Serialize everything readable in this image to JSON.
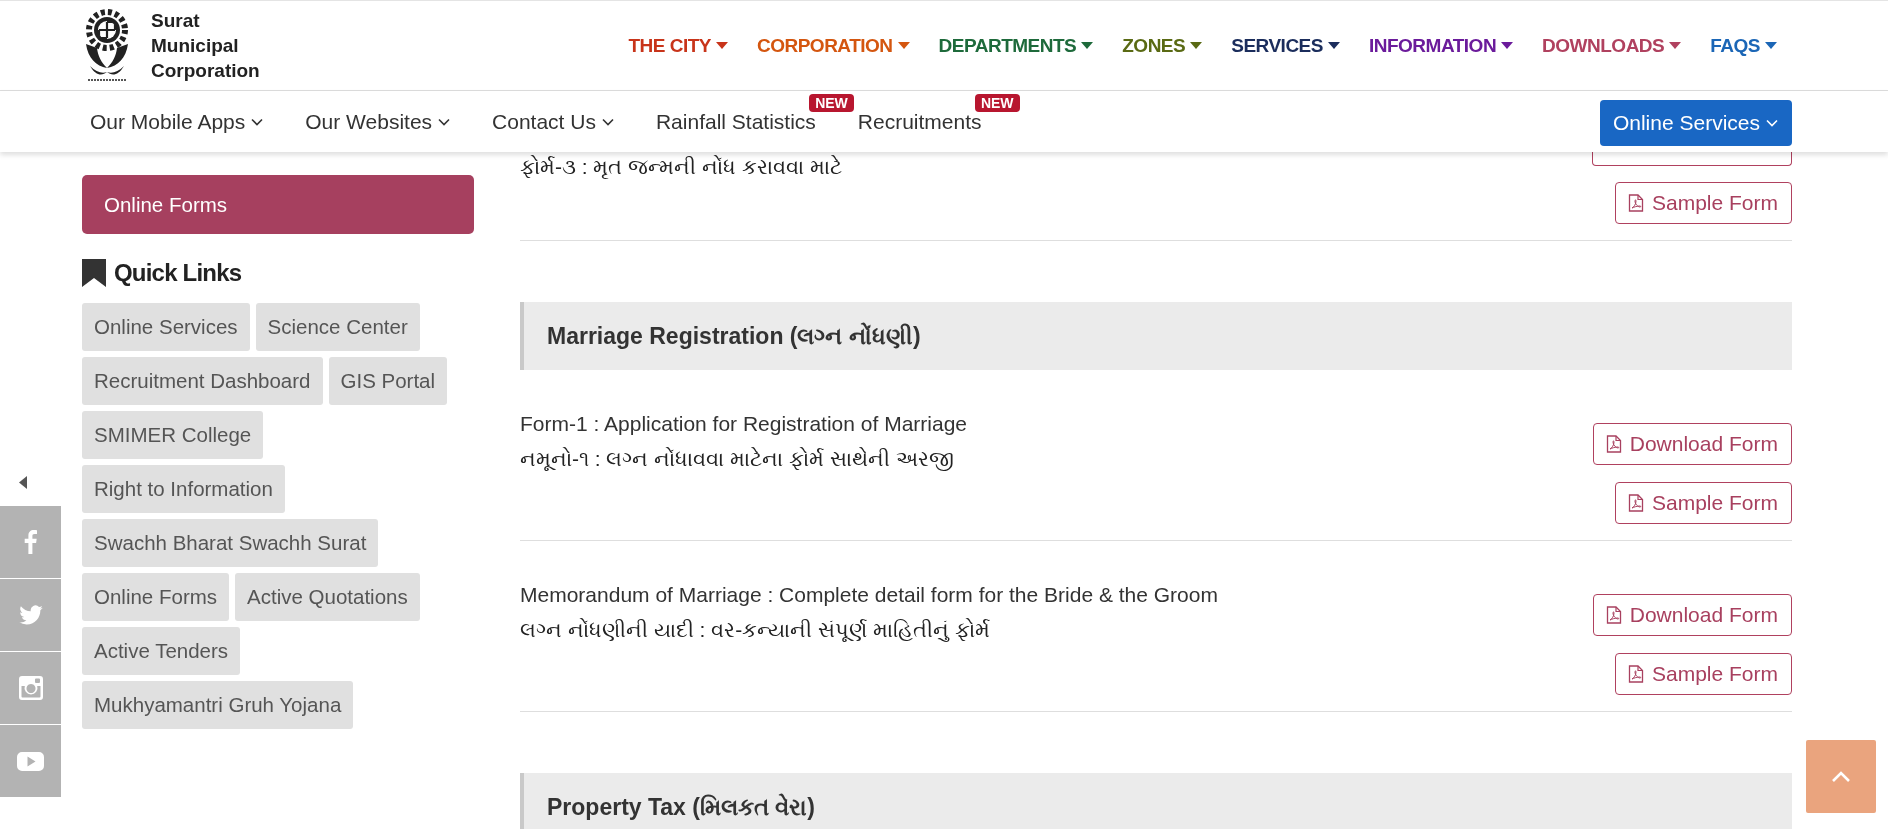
{
  "header": {
    "logo_text": "Surat Municipal Corporation",
    "nav": [
      {
        "label": "THE CITY",
        "color": "#c8341a"
      },
      {
        "label": "CORPORATION",
        "color": "#d4560f"
      },
      {
        "label": "DEPARTMENTS",
        "color": "#1e6a3b"
      },
      {
        "label": "ZONES",
        "color": "#5a6a14"
      },
      {
        "label": "SERVICES",
        "color": "#1b2d5c"
      },
      {
        "label": "INFORMATION",
        "color": "#6b1b9b"
      },
      {
        "label": "DOWNLOADS",
        "color": "#b0415f"
      },
      {
        "label": "FAQS",
        "color": "#1b66b6"
      }
    ]
  },
  "subnav": {
    "items": [
      {
        "label": "Our Mobile Apps",
        "kind": "dropdown"
      },
      {
        "label": "Our Websites",
        "kind": "dropdown"
      },
      {
        "label": "Contact Us",
        "kind": "dropdown"
      },
      {
        "label": "Rainfall Statistics",
        "kind": "link",
        "badge": "NEW"
      },
      {
        "label": "Recruitments",
        "kind": "link",
        "badge": "NEW"
      }
    ],
    "online_services": "Online Services"
  },
  "sidebar": {
    "active_item": "Online Forms",
    "quick_links_title": "Quick Links",
    "quick_links": [
      "Online Services",
      "Science Center",
      "Recruitment Dashboard",
      "GIS Portal",
      "SMIMER College",
      "Right to Information",
      "Swachh Bharat Swachh Surat",
      "Online Forms",
      "Active Quotations",
      "Active Tenders",
      "Mukhyamantri Gruh Yojana"
    ]
  },
  "content": [
    {
      "kind": "form",
      "gujarati": "ફોર્મ-૩ : મૃત જન્મની નોંધ કરાવવા માટે",
      "buttons": [
        {
          "kind": "clipped"
        },
        {
          "kind": "full",
          "label": "Sample Form"
        }
      ]
    },
    {
      "kind": "section",
      "title": "Marriage Registration (લગ્ન નોંધણી)"
    },
    {
      "kind": "form",
      "english": "Form-1 : Application for Registration of Marriage",
      "gujarati": "નમૂનો-૧ : લગ્ન નોંધાવવા માટેના ફોર્મ સાથેની અરજી",
      "buttons": [
        {
          "kind": "full",
          "label": "Download Form"
        },
        {
          "kind": "full",
          "label": "Sample Form"
        }
      ]
    },
    {
      "kind": "form",
      "english": "Memorandum of Marriage : Complete detail form for the Bride & the Groom",
      "gujarati": "લગ્ન નોંધણીની યાદી : વર-કન્યાની સંપૂર્ણ માહિતીનું ફોર્મ",
      "buttons": [
        {
          "kind": "full",
          "label": "Download Form"
        },
        {
          "kind": "full",
          "label": "Sample Form"
        }
      ]
    },
    {
      "kind": "section",
      "title": "Property Tax (મિલકત વેરા)"
    }
  ]
}
